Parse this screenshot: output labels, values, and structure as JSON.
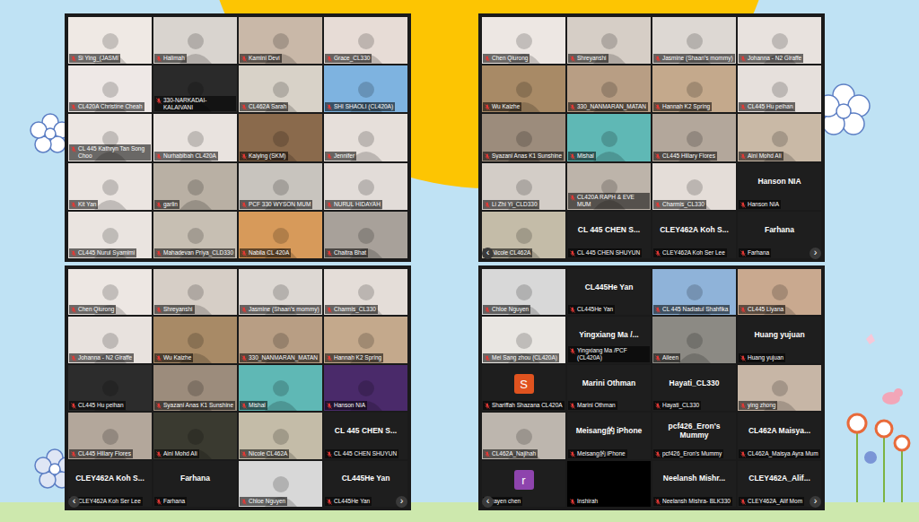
{
  "panels": [
    {
      "tiles": [
        {
          "kind": "video",
          "label": "Si Ying_(JASMI",
          "muted": true,
          "color": "#efe9e4"
        },
        {
          "kind": "video",
          "label": "Halimah",
          "muted": true,
          "color": "#d9d4cf"
        },
        {
          "kind": "video",
          "label": "Kamini Devi",
          "muted": true,
          "color": "#c9b8a8"
        },
        {
          "kind": "video",
          "label": "Grace_CL330",
          "muted": true,
          "color": "#e7dcd6"
        },
        {
          "kind": "video",
          "label": "CL420A Christine Cheah",
          "muted": true,
          "color": "#eee8e6"
        },
        {
          "kind": "video",
          "label": "330-NARKADAI-KALAIVANI",
          "muted": true,
          "color": "#2a2a2a"
        },
        {
          "kind": "video",
          "label": "CL462A Sarah",
          "muted": true,
          "color": "#d8d2c8"
        },
        {
          "kind": "video",
          "label": "SHI SHAOLI (CL420A)",
          "muted": true,
          "color": "#7eb3e0"
        },
        {
          "kind": "video",
          "label": "CL 445 Kathryn Tan Song Choo",
          "muted": true,
          "color": "#ece6e2"
        },
        {
          "kind": "video",
          "label": "Nurhabibah CL420A",
          "muted": true,
          "color": "#e9e3df"
        },
        {
          "kind": "video",
          "label": "Kaiying (SKM)",
          "muted": true,
          "color": "#8a6a4c"
        },
        {
          "kind": "video",
          "label": "Jennifer",
          "muted": true,
          "color": "#e6dfda"
        },
        {
          "kind": "video",
          "label": "Kit Yan",
          "muted": true,
          "color": "#ebe5e1"
        },
        {
          "kind": "video",
          "label": "garlin",
          "muted": true,
          "color": "#b9b0a4"
        },
        {
          "kind": "video",
          "label": "PCF 330 WYSON MUM",
          "muted": true,
          "color": "#c8c4be"
        },
        {
          "kind": "video",
          "label": "NURUL HIDAYAH",
          "muted": true,
          "color": "#e2dcd8"
        },
        {
          "kind": "video",
          "label": "CL445 Nurul Syamimi",
          "muted": true,
          "color": "#eae4e0"
        },
        {
          "kind": "video",
          "label": "Mahadevan Priya_CLD330",
          "muted": true,
          "color": "#c7bfb3"
        },
        {
          "kind": "video",
          "label": "Nabila CL 420A",
          "muted": true,
          "color": "#d79a5a"
        },
        {
          "kind": "video",
          "label": "Chaitra Bhat",
          "muted": true,
          "color": "#a8a19a"
        }
      ]
    },
    {
      "prev": "‹",
      "next": "›",
      "tiles": [
        {
          "kind": "video",
          "label": "Chen Qiurong",
          "muted": true,
          "color": "#ede7e3"
        },
        {
          "kind": "video",
          "label": "Shreyanshi",
          "muted": true,
          "color": "#d6cec6"
        },
        {
          "kind": "video",
          "label": "Jasmine (Shaan's mommy)",
          "muted": true,
          "color": "#ddd8d3"
        },
        {
          "kind": "video",
          "label": "Johanna - N2 Giraffe",
          "muted": true,
          "color": "#e8e2de"
        },
        {
          "kind": "video",
          "label": "Wu Kaizhe",
          "muted": true,
          "color": "#a88a66"
        },
        {
          "kind": "video",
          "label": "330_NANMARAN_MATAN",
          "muted": true,
          "color": "#b89e84"
        },
        {
          "kind": "video",
          "label": "Hannah K2 Spring",
          "muted": true,
          "color": "#c4a98c"
        },
        {
          "kind": "video",
          "label": "CL445 Hu peihan",
          "muted": true,
          "color": "#e6e0dc"
        },
        {
          "kind": "video",
          "label": "Syazani Anas K1 Sunshine",
          "muted": true,
          "color": "#9c8c7c"
        },
        {
          "kind": "video",
          "label": "Mishal",
          "muted": true,
          "color": "#5fb8b5"
        },
        {
          "kind": "video",
          "label": "CL445 Hillary Flores",
          "muted": true,
          "color": "#b3a79b"
        },
        {
          "kind": "video",
          "label": "Aini Mohd Ali",
          "muted": true,
          "color": "#c9b9a6"
        },
        {
          "kind": "video",
          "label": "Li Zhi Yi_CLD330",
          "muted": true,
          "color": "#d3cdc7"
        },
        {
          "kind": "video",
          "label": "CL420A RAPH & EVE MUM",
          "muted": true,
          "color": "#bdb4aa"
        },
        {
          "kind": "video",
          "label": "Charmis_CL330",
          "muted": true,
          "color": "#e4ddd8"
        },
        {
          "kind": "name",
          "name": "Hanson NIA",
          "label": "Hanson NIA",
          "muted": true
        },
        {
          "kind": "video",
          "label": "Nicole CL462A",
          "muted": true,
          "color": "#c4bca8"
        },
        {
          "kind": "name",
          "name": "CL 445 CHEN S...",
          "label": "CL 445 CHEN SHUYUN",
          "muted": true
        },
        {
          "kind": "name",
          "name": "CLEY462A Koh S...",
          "label": "CLEY462A Koh Ser Lee",
          "muted": true
        },
        {
          "kind": "name",
          "name": "Farhana",
          "label": "Farhana",
          "muted": true
        }
      ]
    },
    {
      "prev": "‹",
      "next": "›",
      "tiles": [
        {
          "kind": "video",
          "label": "Chen Qiurong",
          "muted": true,
          "color": "#ede7e3"
        },
        {
          "kind": "video",
          "label": "Shreyanshi",
          "muted": true,
          "color": "#d6cec6"
        },
        {
          "kind": "video",
          "label": "Jasmine (Shaan's mommy)",
          "muted": true,
          "color": "#ddd8d3"
        },
        {
          "kind": "video",
          "label": "Charmis_CL330",
          "muted": true,
          "color": "#e4ddd8"
        },
        {
          "kind": "video",
          "label": "Johanna - N2 Giraffe",
          "muted": true,
          "color": "#e8e2de"
        },
        {
          "kind": "video",
          "label": "Wu Kaizhe",
          "muted": true,
          "color": "#a88a66"
        },
        {
          "kind": "video",
          "label": "330_NANMARAN_MATAN",
          "muted": true,
          "color": "#b89e84"
        },
        {
          "kind": "video",
          "label": "Hannah K2 Spring",
          "muted": true,
          "color": "#c4a98c"
        },
        {
          "kind": "video",
          "label": "CL445 Hu peihan",
          "muted": true,
          "color": "#2c2c2c"
        },
        {
          "kind": "video",
          "label": "Syazani Anas K1 Sunshine",
          "muted": true,
          "color": "#9c8c7c"
        },
        {
          "kind": "video",
          "label": "Mishal",
          "muted": true,
          "color": "#5fb8b5"
        },
        {
          "kind": "video",
          "label": "Hanson NIA",
          "muted": true,
          "color": "#4a2a6a"
        },
        {
          "kind": "video",
          "label": "CL445 Hillary Flores",
          "muted": true,
          "color": "#b3a79b"
        },
        {
          "kind": "video",
          "label": "Aini Mohd Ali",
          "muted": true,
          "color": "#3a3a30"
        },
        {
          "kind": "video",
          "label": "Nicole CL462A",
          "muted": true,
          "color": "#c4bca8"
        },
        {
          "kind": "name",
          "name": "CL 445 CHEN S...",
          "label": "CL 445 CHEN SHUYUN",
          "muted": true
        },
        {
          "kind": "name",
          "name": "CLEY462A Koh S...",
          "label": "CLEY462A Koh Ser Lee",
          "muted": true
        },
        {
          "kind": "name",
          "name": "Farhana",
          "label": "Farhana",
          "muted": true
        },
        {
          "kind": "video",
          "label": "Chloe Nguyen",
          "muted": true,
          "color": "#d8d8d8"
        },
        {
          "kind": "name",
          "name": "CL445He Yan",
          "label": "CL445He Yan",
          "muted": true
        }
      ]
    },
    {
      "prev": "‹",
      "next": "›",
      "tiles": [
        {
          "kind": "video",
          "label": "Chloe Nguyen",
          "muted": true,
          "color": "#d8d8d8"
        },
        {
          "kind": "name",
          "name": "CL445He Yan",
          "label": "CL445He Yan",
          "muted": true
        },
        {
          "kind": "video",
          "label": "CL 445 Nadiatul Shahfika",
          "muted": true,
          "color": "#8fb3d9"
        },
        {
          "kind": "video",
          "label": "CL445 Liyana",
          "muted": true,
          "color": "#c9a98f"
        },
        {
          "kind": "video",
          "label": "Mei Sang zhou (CL420A)",
          "muted": true,
          "color": "#e9e6e2"
        },
        {
          "kind": "name",
          "name": "Yingxiang Ma /...",
          "label": "Yingxiang Ma /PCF (CL420A)",
          "muted": true
        },
        {
          "kind": "video",
          "label": "Aileen",
          "muted": true,
          "color": "#8c8a84"
        },
        {
          "kind": "name",
          "name": "Huang yujuan",
          "label": "Huang yujuan",
          "muted": true
        },
        {
          "kind": "avatar",
          "letter": "S",
          "label": "Shariffah Shazana CL420A",
          "muted": true,
          "color": "#e0531f"
        },
        {
          "kind": "name",
          "name": "Marini Othman",
          "label": "Marini Othman",
          "muted": true
        },
        {
          "kind": "name",
          "name": "Hayati_CL330",
          "label": "Hayati_CL330",
          "muted": true
        },
        {
          "kind": "video",
          "label": "ying zhong",
          "muted": true,
          "color": "#c7b6a6"
        },
        {
          "kind": "video",
          "label": "CL462A_Najihah",
          "muted": true,
          "color": "#bdb6ae"
        },
        {
          "kind": "name",
          "name": "Meisang的 iPhone",
          "label": "Meisang的 iPhone",
          "muted": true
        },
        {
          "kind": "name",
          "name": "pcf426_Eron's Mummy",
          "label": "pcf426_Eron's Mummy",
          "muted": true
        },
        {
          "kind": "name",
          "name": "CL462A Maisya...",
          "label": "CL462A_Maisya Ayra Mum",
          "muted": true
        },
        {
          "kind": "avatar",
          "letter": "r",
          "label": "rayen chen",
          "muted": true,
          "color": "#8e44ad"
        },
        {
          "kind": "video",
          "label": "Inshirah",
          "muted": true,
          "color": "#000000"
        },
        {
          "kind": "name",
          "name": "Neelansh Mishr...",
          "label": "Neelansh Mishra- BLK330",
          "muted": true
        },
        {
          "kind": "name",
          "name": "CLEY462A_Alif...",
          "label": "CLEY462A_Alif Mom",
          "muted": true
        }
      ]
    }
  ]
}
